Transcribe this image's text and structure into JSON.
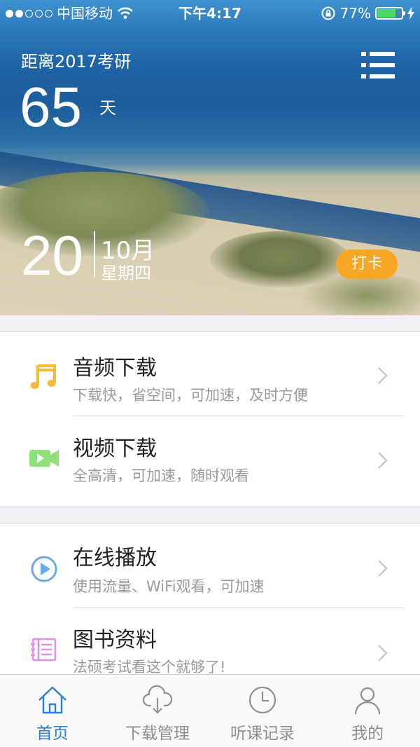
{
  "status_bar": {
    "carrier": "中国移动",
    "time": "下午4:17",
    "battery_percent": "77%",
    "battery_level": 0.77,
    "signal_dots_filled": 2,
    "signal_dots_total": 5
  },
  "hero": {
    "countdown_label": "距离2017考研",
    "countdown_days": "65",
    "countdown_unit": "天",
    "day": "20",
    "month": "10月",
    "weekday": "星期四",
    "checkin_label": "打卡"
  },
  "menu": [
    {
      "title": "音频下载",
      "subtitle": "下载快，省空间，可加速，及时方便",
      "icon": "music-note-icon",
      "color": "#f5b93b"
    },
    {
      "title": "视频下载",
      "subtitle": "全高清，可加速，随时观看",
      "icon": "video-camera-icon",
      "color": "#8ee07a"
    },
    {
      "title": "在线播放",
      "subtitle": "使用流量、WiFi观看，可加速",
      "icon": "play-circle-icon",
      "color": "#6aaaf0"
    },
    {
      "title": "图书资料",
      "subtitle": "法硕考试看这个就够了!",
      "icon": "book-icon",
      "color": "#e08ee8"
    }
  ],
  "tabs": [
    {
      "label": "首页",
      "icon": "home-icon",
      "active": true
    },
    {
      "label": "下载管理",
      "icon": "cloud-download-icon",
      "active": false
    },
    {
      "label": "听课记录",
      "icon": "clock-icon",
      "active": false
    },
    {
      "label": "我的",
      "icon": "user-icon",
      "active": false
    }
  ],
  "colors": {
    "accent": "#2d7fd4",
    "checkin": "#f5a623",
    "battery": "#4cd964"
  }
}
